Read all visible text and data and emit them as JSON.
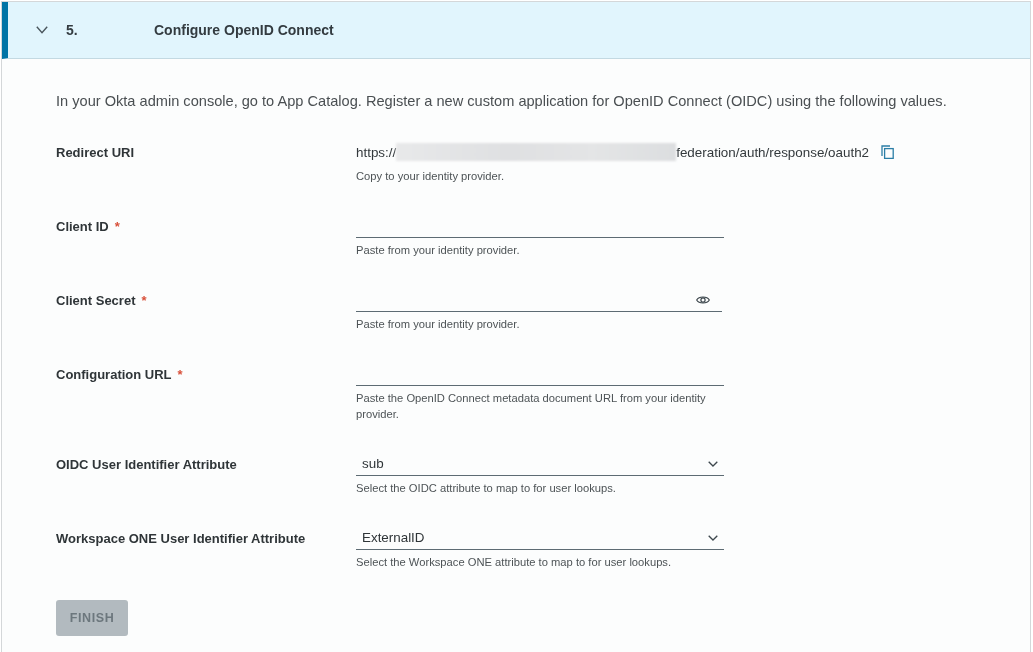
{
  "section": {
    "number": "5.",
    "title": "Configure OpenID Connect",
    "expanded": true
  },
  "intro": "In your Okta admin console, go to App Catalog. Register a new custom application for OpenID Connect (OIDC) using the following values.",
  "fields": [
    {
      "kind": "readonly",
      "label": "Redirect URI",
      "value_start": "https://",
      "redacted": true,
      "value_end": "federation/auth/response/oauth2",
      "hint": "Copy to your identity provider."
    },
    {
      "kind": "text",
      "label": "Client ID",
      "required_mark": "*",
      "hint": "Paste from your identity provider."
    },
    {
      "kind": "password",
      "label": "Client Secret",
      "required_mark": "*",
      "hint": "Paste from your identity provider."
    },
    {
      "kind": "text",
      "label": "Configuration URL",
      "required_mark": "*",
      "hint": "Paste the OpenID Connect metadata document URL from your identity provider."
    },
    {
      "kind": "select",
      "label": "OIDC User Identifier Attribute",
      "value": "sub",
      "hint": "Select the OIDC attribute to map to for user lookups."
    },
    {
      "kind": "select",
      "label": "Workspace ONE User Identifier Attribute",
      "value": "ExternalID",
      "hint": "Select the Workspace ONE attribute to map to for user lookups."
    }
  ],
  "finish_button": {
    "label": "FINISH",
    "disabled": true
  }
}
